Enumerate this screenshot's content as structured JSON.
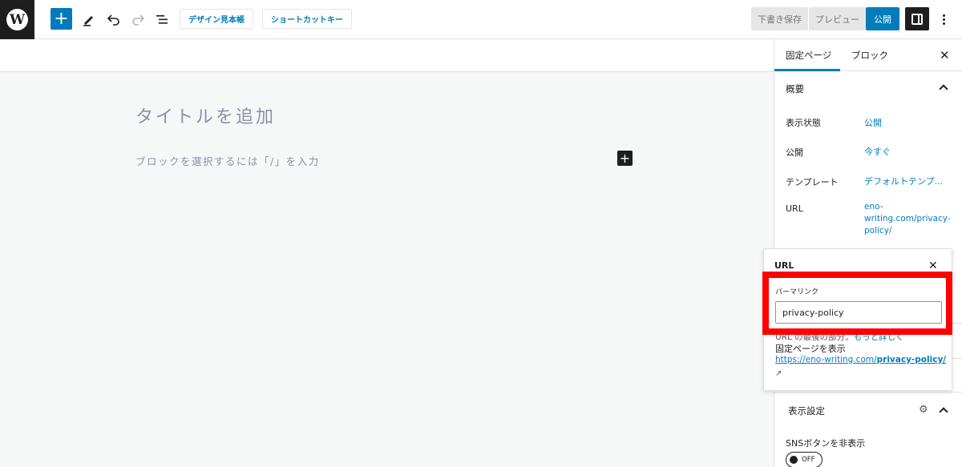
{
  "toolbar": {
    "logo_glyph": "W",
    "add_glyph": "+",
    "icons": [
      "pencil-icon",
      "undo-icon",
      "redo-icon",
      "list-view-icon"
    ],
    "pattern_button": "デザイン見本帳",
    "shortcut_button": "ショートカットキー",
    "save_draft": "下書き保存",
    "preview": "プレビュー",
    "publish": "公開"
  },
  "editor": {
    "title_placeholder": "タイトルを追加",
    "block_placeholder": "ブロックを選択するには「/」を入力",
    "inserter_glyph": "+"
  },
  "sidebar": {
    "tabs": [
      {
        "label": "固定ページ",
        "active": true
      },
      {
        "label": "ブロック",
        "active": false
      }
    ],
    "close_glyph": "✕",
    "summary": {
      "title": "概要",
      "rows": [
        {
          "label": "表示状態",
          "value": "公開"
        },
        {
          "label": "公開",
          "value": "今すぐ"
        },
        {
          "label": "テンプレート",
          "value": "デフォルトテンプ..."
        },
        {
          "label": "URL",
          "value": "eno-writing.com/privacy-policy/"
        }
      ]
    },
    "display_settings": {
      "title": "表示設定",
      "sns_label": "SNSボタンを非表示",
      "toggle_state": "OFF"
    }
  },
  "url_popover": {
    "title": "URL",
    "close_glyph": "✕",
    "permalink_label": "パーマリンク",
    "permalink_value": "privacy-policy",
    "sub_text": "URL の最後の部分。",
    "sub_link": "もっと詳しく",
    "view_label": "固定ページを表示",
    "view_link_prefix": "https://eno-writing.com/",
    "view_link_slug": "privacy-policy/",
    "ext_glyph": "↗"
  },
  "colors": {
    "accent": "#007cba",
    "highlight": "#ff0000",
    "dark": "#1e1e1e",
    "canvas": "#f6f7f7"
  }
}
